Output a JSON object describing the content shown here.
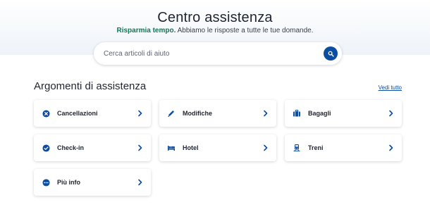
{
  "header": {
    "title": "Centro assistenza",
    "subtitle_highlight": "Risparmia tempo.",
    "subtitle_rest": " Abbiamo le risposte a tutte le tue domande."
  },
  "search": {
    "placeholder": "Cerca articoli di aiuto",
    "value": "",
    "icon": "search-icon"
  },
  "topics": {
    "title": "Argomenti di assistenza",
    "see_all": "Vedi tutto",
    "items": [
      {
        "label": "Cancellazioni",
        "icon": "cancel-icon"
      },
      {
        "label": "Modifiche",
        "icon": "pencil-icon"
      },
      {
        "label": "Bagagli",
        "icon": "luggage-icon"
      },
      {
        "label": "Check-in",
        "icon": "check-circle-icon"
      },
      {
        "label": "Hotel",
        "icon": "bed-icon"
      },
      {
        "label": "Treni",
        "icon": "train-icon"
      },
      {
        "label": "Più info",
        "icon": "more-icon"
      }
    ]
  },
  "colors": {
    "accent": "#0b4da2",
    "highlight_green": "#0f7a55"
  }
}
